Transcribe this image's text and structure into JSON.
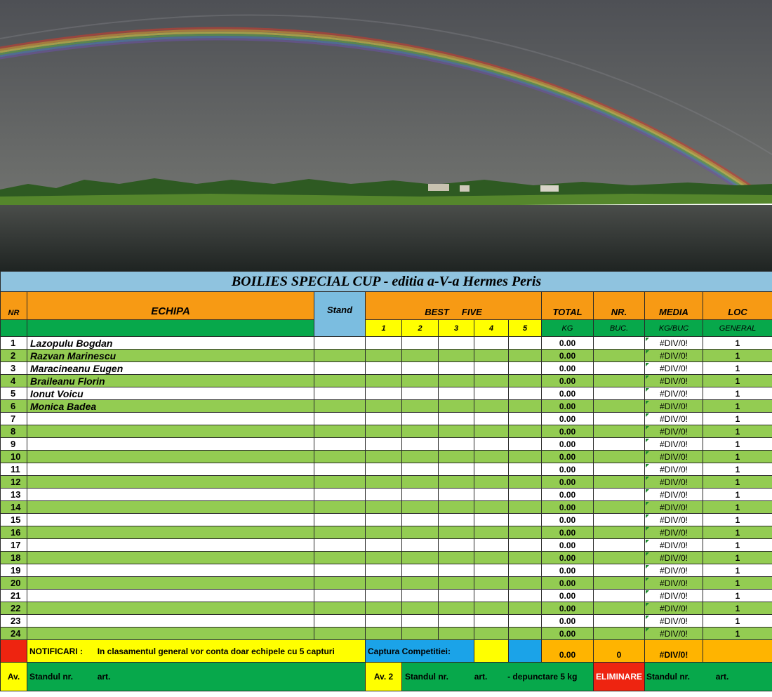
{
  "title": "BOILIES SPECIAL CUP - editia a-V-a Hermes Peris",
  "headers": {
    "nr": "NR",
    "echipa": "ECHIPA",
    "stand": "Stand",
    "best_five": "BEST     FIVE",
    "total": "TOTAL",
    "nr_buc": "NR.",
    "media": "MEDIA",
    "loc": "LOC",
    "sub_best": [
      "1",
      "2",
      "3",
      "4",
      "5"
    ],
    "kg": "KG",
    "buc": "BUC.",
    "kgbuc": "KG/BUC",
    "general": "GENERAL"
  },
  "rows": [
    {
      "nr": "1",
      "team": "Lazopulu Bogdan",
      "total": "0.00",
      "media": "#DIV/0!",
      "loc": "1"
    },
    {
      "nr": "2",
      "team": "Razvan Marinescu",
      "total": "0.00",
      "media": "#DIV/0!",
      "loc": "1"
    },
    {
      "nr": "3",
      "team": "Maracineanu Eugen",
      "total": "0.00",
      "media": "#DIV/0!",
      "loc": "1"
    },
    {
      "nr": "4",
      "team": "Braileanu Florin",
      "total": "0.00",
      "media": "#DIV/0!",
      "loc": "1"
    },
    {
      "nr": "5",
      "team": "Ionut Voicu",
      "total": "0.00",
      "media": "#DIV/0!",
      "loc": "1"
    },
    {
      "nr": "6",
      "team": "Monica Badea",
      "total": "0.00",
      "media": "#DIV/0!",
      "loc": "1"
    },
    {
      "nr": "7",
      "team": "",
      "total": "0.00",
      "media": "#DIV/0!",
      "loc": "1"
    },
    {
      "nr": "8",
      "team": "",
      "total": "0.00",
      "media": "#DIV/0!",
      "loc": "1"
    },
    {
      "nr": "9",
      "team": "",
      "total": "0.00",
      "media": "#DIV/0!",
      "loc": "1"
    },
    {
      "nr": "10",
      "team": "",
      "total": "0.00",
      "media": "#DIV/0!",
      "loc": "1"
    },
    {
      "nr": "11",
      "team": "",
      "total": "0.00",
      "media": "#DIV/0!",
      "loc": "1"
    },
    {
      "nr": "12",
      "team": "",
      "total": "0.00",
      "media": "#DIV/0!",
      "loc": "1"
    },
    {
      "nr": "13",
      "team": "",
      "total": "0.00",
      "media": "#DIV/0!",
      "loc": "1"
    },
    {
      "nr": "14",
      "team": "",
      "total": "0.00",
      "media": "#DIV/0!",
      "loc": "1"
    },
    {
      "nr": "15",
      "team": "",
      "total": "0.00",
      "media": "#DIV/0!",
      "loc": "1"
    },
    {
      "nr": "16",
      "team": "",
      "total": "0.00",
      "media": "#DIV/0!",
      "loc": "1"
    },
    {
      "nr": "17",
      "team": "",
      "total": "0.00",
      "media": "#DIV/0!",
      "loc": "1"
    },
    {
      "nr": "18",
      "team": "",
      "total": "0.00",
      "media": "#DIV/0!",
      "loc": "1"
    },
    {
      "nr": "19",
      "team": "",
      "total": "0.00",
      "media": "#DIV/0!",
      "loc": "1"
    },
    {
      "nr": "20",
      "team": "",
      "total": "0.00",
      "media": "#DIV/0!",
      "loc": "1"
    },
    {
      "nr": "21",
      "team": "",
      "total": "0.00",
      "media": "#DIV/0!",
      "loc": "1"
    },
    {
      "nr": "22",
      "team": "",
      "total": "0.00",
      "media": "#DIV/0!",
      "loc": "1"
    },
    {
      "nr": "23",
      "team": "",
      "total": "0.00",
      "media": "#DIV/0!",
      "loc": "1"
    },
    {
      "nr": "24",
      "team": "",
      "total": "0.00",
      "media": "#DIV/0!",
      "loc": "1"
    }
  ],
  "footer": {
    "notificari_label": "NOTIFICARI :",
    "notificari_text": "In clasamentul general vor conta doar echipele cu 5 capturi",
    "captura_label": "Captura Competitiei:",
    "total": "0.00",
    "buc": "0",
    "media": "#DIV/0!",
    "av1": "Av.",
    "standul_nr": "Standul nr.",
    "art": "art.",
    "av2": "Av. 2",
    "standul_nr2": "Standul nr.",
    "art2": "art.",
    "depunctare": "- depunctare 5 kg",
    "eliminare": "ELIMINARE",
    "standul_nr3": "Standul  nr.",
    "art3": "art."
  },
  "colors": {
    "title_bg": "#8fc3df",
    "header_orange": "#f79a14",
    "header_green": "#07a84b",
    "row_green": "#93cc52",
    "yellow": "#ffff00",
    "red": "#ee2410"
  },
  "photo": {
    "scene": "rainbow-over-lake"
  }
}
